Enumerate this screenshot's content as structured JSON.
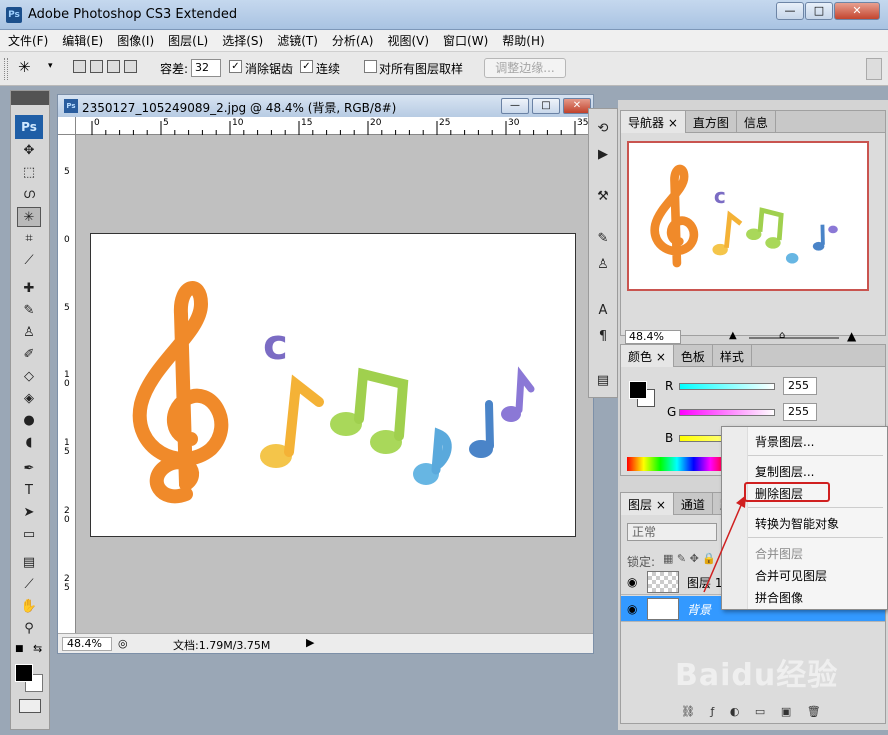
{
  "app": {
    "title": "Adobe Photoshop CS3 Extended",
    "logo": "Ps"
  },
  "menubar": [
    "文件(F)",
    "编辑(E)",
    "图像(I)",
    "图层(L)",
    "选择(S)",
    "滤镜(T)",
    "分析(A)",
    "视图(V)",
    "窗口(W)",
    "帮助(H)"
  ],
  "options": {
    "tolerance_label": "容差:",
    "tolerance_value": "32",
    "antialias_label": "消除锯齿",
    "antialias_checked": true,
    "contiguous_label": "连续",
    "contiguous_checked": true,
    "sample_all_label": "对所有图层取样",
    "sample_all_checked": false,
    "refine_edge_label": "调整边缘..."
  },
  "document": {
    "title": "2350127_105249089_2.jpg @ 48.4% (背景, RGB/8#)",
    "zoom": "48.4%",
    "doc_size": "文档:1.79M/3.75M",
    "ruler_h": [
      "0",
      "5",
      "10",
      "15",
      "20",
      "25",
      "30",
      "35"
    ],
    "ruler_v": [
      "5",
      "0",
      "5",
      "1\n0",
      "1\n5",
      "2\n0",
      "2\n5"
    ],
    "canvas_letter": "c"
  },
  "navigator": {
    "tabs": [
      "导航器",
      "直方图",
      "信息"
    ],
    "zoom": "48.4%"
  },
  "color": {
    "tabs": [
      "颜色",
      "色板",
      "样式"
    ],
    "channels": [
      {
        "label": "R",
        "value": "255"
      },
      {
        "label": "G",
        "value": "255"
      },
      {
        "label": "B",
        "value": ""
      }
    ]
  },
  "layers": {
    "tabs": [
      "图层",
      "通道",
      "路"
    ],
    "blend_mode": "正常",
    "lock_label": "锁定:",
    "rows": [
      {
        "name": "图层 1",
        "selected": false
      },
      {
        "name": "背景",
        "selected": true
      }
    ]
  },
  "context_menu": {
    "items": [
      "背景图层...",
      "复制图层...",
      "删除图层",
      "转换为智能对象",
      "合并图层",
      "合并可见图层",
      "拼合图像"
    ],
    "highlighted": "删除图层",
    "disabled": [
      "合并图层"
    ]
  },
  "watermark": "Baidu经验",
  "colors": {
    "accent_red": "#d02020",
    "selection_blue": "#3399ff",
    "ps_blue": "#1f5ea6"
  }
}
